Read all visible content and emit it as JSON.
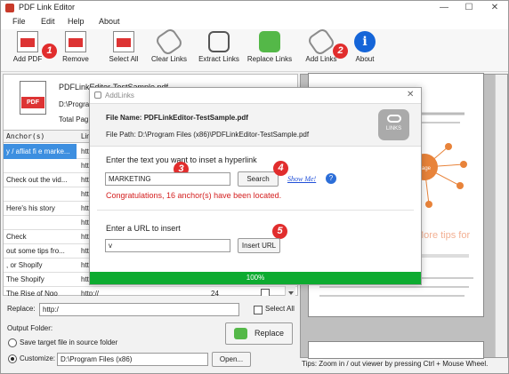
{
  "window": {
    "title": "PDF Link Editor",
    "minimize": "—",
    "maximize": "☐",
    "close": "✕"
  },
  "menu": [
    "File",
    "Edit",
    "Help",
    "About"
  ],
  "toolbar": {
    "add_pdf": "Add PDF",
    "remove": "Remove",
    "select_all": "Select All",
    "clear_links": "Clear Links",
    "extract_links": "Extract Links",
    "replace_links": "Replace Links",
    "add_links": "Add Links",
    "about": "About"
  },
  "callouts": [
    "1",
    "2",
    "3",
    "4",
    "5"
  ],
  "document": {
    "file_name": "PDFLinkEditor-TestSample.pdf",
    "path_partial": "D:\\Program",
    "total_pages_partial": "Total Pag"
  },
  "table": {
    "headers": [
      "Anchor(s)",
      "Lin"
    ],
    "rows": [
      {
        "anchor": "y / afliat fi e marke...",
        "link": "http",
        "selected": true
      },
      {
        "anchor": "",
        "link": "http",
        "selected": false
      },
      {
        "anchor": "Check out the vid...",
        "link": "http",
        "selected": false
      },
      {
        "anchor": "",
        "link": "http",
        "selected": false
      },
      {
        "anchor": "Here's his story",
        "link": "http",
        "selected": false
      },
      {
        "anchor": "",
        "link": "http",
        "selected": false
      },
      {
        "anchor": "Check",
        "link": "http",
        "selected": false
      },
      {
        "anchor": "out some tips fro...",
        "link": "http",
        "selected": false
      },
      {
        "anchor": ", or Shopify",
        "link": "http",
        "selected": false
      },
      {
        "anchor": "The Shopify",
        "link": "http",
        "selected": false
      },
      {
        "anchor": "The Rise of Ngo",
        "link": "http://",
        "page": "24",
        "selected": false
      }
    ]
  },
  "bottom": {
    "replace_label": "Replace:",
    "replace_value": "http:/",
    "select_all_label": "Select All",
    "output_folder_label": "Output Folder:",
    "save_source_label": "Save target file in source folder",
    "customize_label": "Customize:",
    "customize_path": "D:\\Program Files (x86)",
    "open_button": "Open...",
    "replace_button": "Replace"
  },
  "viewer": {
    "tips": "Tips: Zoom in / out viewer by pressing Ctrl + Mouse Wheel."
  },
  "dialog": {
    "title": "AddLinks",
    "file_name_label": "File Name:",
    "file_name_value": "PDFLinkEditor-TestSample.pdf",
    "file_path_label": "File Path:",
    "file_path_value": "D:\\Program Files (x86)\\PDFLinkEditor-TestSample.pdf",
    "links_icon_label": "LINKS",
    "hyperlink_prompt": "Enter the text you want to inset a hyperlink",
    "hyperlink_value": "MARKETING",
    "search_button": "Search",
    "show_me": "Show Me!",
    "help_glyph": "?",
    "found_message": "Congratulations, 16 anchor(s) have been located.",
    "url_prompt": "Enter a URL to insert",
    "url_value": "v",
    "insert_url_button": "Insert URL",
    "progress_text": "100%"
  },
  "colors": {
    "accent_red": "#e12d2d",
    "progress_green": "#0dab30",
    "selection_blue": "#3d8fe0",
    "link_blue": "#1f4fd8"
  }
}
